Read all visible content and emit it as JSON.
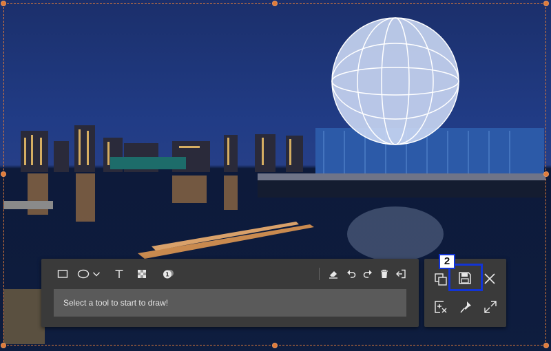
{
  "toolbar": {
    "tools": [
      {
        "id": "rectangle",
        "icon": "rectangle-icon"
      },
      {
        "id": "ellipse",
        "icon": "ellipse-icon"
      },
      {
        "id": "shape-dropdown",
        "icon": "chevron-down-icon"
      },
      {
        "id": "text",
        "icon": "text-icon"
      },
      {
        "id": "mosaic",
        "icon": "mosaic-icon"
      },
      {
        "id": "step-number",
        "icon": "step-number-icon"
      }
    ],
    "edit_actions": [
      {
        "id": "eraser",
        "icon": "eraser-icon"
      },
      {
        "id": "undo",
        "icon": "undo-icon"
      },
      {
        "id": "redo",
        "icon": "redo-icon"
      },
      {
        "id": "delete",
        "icon": "trash-icon"
      },
      {
        "id": "exit",
        "icon": "exit-icon"
      }
    ],
    "hint": "Select a tool to start to draw!"
  },
  "actions": {
    "copy": "copy-icon",
    "save": "save-icon",
    "close": "close-icon",
    "add": "add-frame-icon",
    "pin": "pin-icon",
    "fullscreen": "fullscreen-icon"
  },
  "annotation": {
    "step_label": "2",
    "highlight_color": "#1234d6"
  },
  "colors": {
    "selection_border": "#e07b39",
    "panel_bg": "#3a3a3a",
    "hint_bg": "#5a5a5a"
  }
}
